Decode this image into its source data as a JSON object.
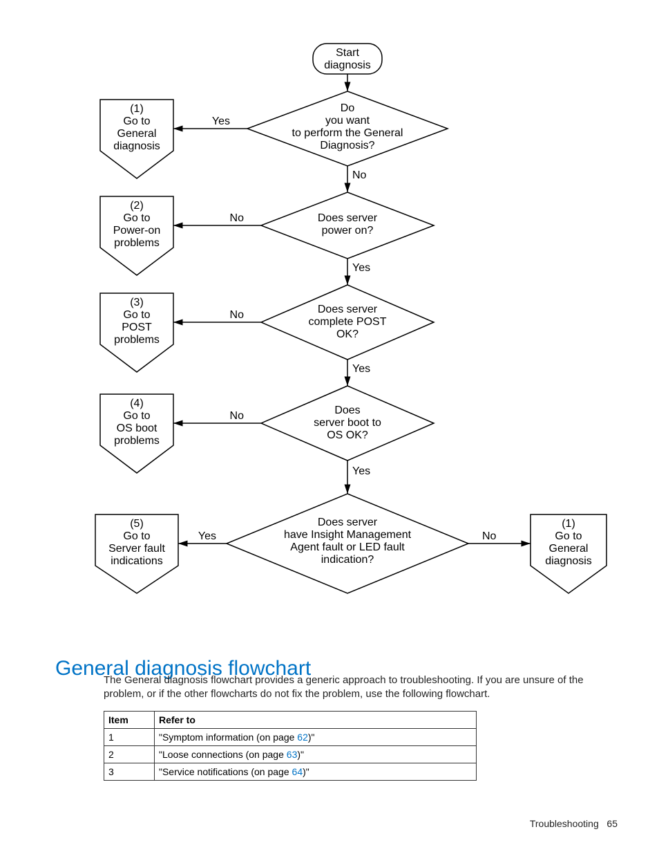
{
  "footer": {
    "section": "Troubleshooting",
    "page": "65"
  },
  "heading": "General diagnosis flowchart",
  "body": "The General diagnosis flowchart provides a generic approach to troubleshooting. If you are unsure of the problem, or if the other flowcharts do not fix the problem, use the following flowchart.",
  "table": {
    "head_item": "Item",
    "head_ref": "Refer to",
    "rows": [
      {
        "n": "1",
        "pre": "\"Symptom information (on page ",
        "pg": "62",
        "post": ")\""
      },
      {
        "n": "2",
        "pre": "\"Loose connections (on page ",
        "pg": "63",
        "post": ")\""
      },
      {
        "n": "3",
        "pre": "\"Service notifications (on page ",
        "pg": "64",
        "post": ")\""
      }
    ]
  },
  "chart_data": {
    "type": "flowchart",
    "nodes": [
      {
        "id": "start",
        "kind": "terminator",
        "lines": [
          "Start",
          "diagnosis"
        ]
      },
      {
        "id": "q1",
        "kind": "decision",
        "lines": [
          "Do",
          "you want",
          "to perform the General",
          "Diagnosis?"
        ]
      },
      {
        "id": "q2",
        "kind": "decision",
        "lines": [
          "Does server",
          "power on?"
        ]
      },
      {
        "id": "q3",
        "kind": "decision",
        "lines": [
          "Does server",
          "complete POST",
          "OK?"
        ]
      },
      {
        "id": "q4",
        "kind": "decision",
        "lines": [
          "Does",
          "server boot to",
          "OS OK?"
        ]
      },
      {
        "id": "q5",
        "kind": "decision",
        "lines": [
          "Does server",
          "have Insight Management",
          "Agent fault or LED fault",
          "indication?"
        ]
      },
      {
        "id": "out1",
        "kind": "offpage",
        "lines": [
          "(1)",
          "Go to",
          "General",
          "diagnosis"
        ]
      },
      {
        "id": "out2",
        "kind": "offpage",
        "lines": [
          "(2)",
          "Go to",
          "Power-on",
          "problems"
        ]
      },
      {
        "id": "out3",
        "kind": "offpage",
        "lines": [
          "(3)",
          "Go to",
          "POST",
          "problems"
        ]
      },
      {
        "id": "out4",
        "kind": "offpage",
        "lines": [
          "(4)",
          "Go to",
          "OS boot",
          "problems"
        ]
      },
      {
        "id": "out5",
        "kind": "offpage",
        "lines": [
          "(5)",
          "Go to",
          "Server fault",
          "indications"
        ]
      },
      {
        "id": "out1b",
        "kind": "offpage",
        "lines": [
          "(1)",
          "Go to",
          "General",
          "diagnosis"
        ]
      }
    ],
    "edges": [
      {
        "from": "start",
        "to": "q1",
        "label": ""
      },
      {
        "from": "q1",
        "to": "out1",
        "label": "Yes"
      },
      {
        "from": "q1",
        "to": "q2",
        "label": "No"
      },
      {
        "from": "q2",
        "to": "out2",
        "label": "No"
      },
      {
        "from": "q2",
        "to": "q3",
        "label": "Yes"
      },
      {
        "from": "q3",
        "to": "out3",
        "label": "No"
      },
      {
        "from": "q3",
        "to": "q4",
        "label": "Yes"
      },
      {
        "from": "q4",
        "to": "out4",
        "label": "No"
      },
      {
        "from": "q4",
        "to": "q5",
        "label": "Yes"
      },
      {
        "from": "q5",
        "to": "out5",
        "label": "Yes"
      },
      {
        "from": "q5",
        "to": "out1b",
        "label": "No"
      }
    ],
    "labels": {
      "yes": "Yes",
      "no": "No"
    }
  }
}
